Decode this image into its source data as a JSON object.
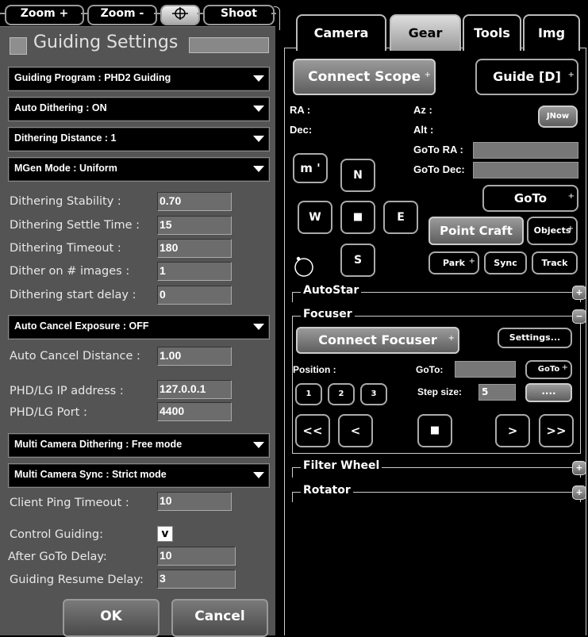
{
  "toolbar": {
    "zoom_in": "Zoom +",
    "zoom_out": "Zoom -",
    "shoot": "Shoot"
  },
  "settings": {
    "title": "Guiding Settings",
    "combos": {
      "program": "Guiding Program : PHD2 Guiding",
      "auto_dither": "Auto Dithering : ON",
      "dither_distance": "Dithering Distance : 1",
      "mgen_mode": "MGen Mode : Uniform",
      "auto_cancel": "Auto Cancel Exposure : OFF",
      "multi_dither": "Multi Camera Dithering : Free mode",
      "multi_sync": "Multi Camera Sync : Strict mode"
    },
    "fields": {
      "stability_label": "Dithering Stability :",
      "stability_value": "0.70",
      "settle_label": "Dithering Settle Time :",
      "settle_value": "15",
      "timeout_label": "Dithering Timeout :",
      "timeout_value": "180",
      "dither_images_label": "Dither on # images :",
      "dither_images_value": "1",
      "start_delay_label": "Dithering start delay :",
      "start_delay_value": "0",
      "cancel_distance_label": "Auto Cancel Distance :",
      "cancel_distance_value": "1.00",
      "ip_label": "PHD/LG IP address :",
      "ip_value": "127.0.0.1",
      "port_label": "PHD/LG Port :",
      "port_value": "4400",
      "ping_label": "Client Ping Timeout :",
      "ping_value": "10",
      "control_label": "Control Guiding:",
      "control_check": "v",
      "after_goto_label": "After GoTo Delay:",
      "after_goto_value": "10",
      "resume_label": "Guiding Resume Delay:",
      "resume_value": "3"
    },
    "ok": "OK",
    "cancel": "Cancel"
  },
  "tabs": [
    "Camera",
    "Gear",
    "Tools",
    "Img"
  ],
  "mount": {
    "connect": "Connect Scope",
    "guide": "Guide [D]",
    "ra": "RA :",
    "dec": "Dec:",
    "az": "Az :",
    "alt": "Alt :",
    "jnow": "JNow",
    "goto_ra": "GoTo RA :",
    "goto_dec": "GoTo Dec:",
    "m_btn": "m '",
    "n": "N",
    "w": "W",
    "stop": "■",
    "e": "E",
    "s": "S",
    "goto": "GoTo",
    "point_craft": "Point Craft",
    "objects": "Objects",
    "park": "Park",
    "sync": "Sync",
    "track": "Track"
  },
  "sections": {
    "autostar": "AutoStar",
    "focuser": "Focuser",
    "filter": "Filter Wheel",
    "rotator": "Rotator"
  },
  "focuser": {
    "connect": "Connect Focuser",
    "settings": "Settings...",
    "position": "Position :",
    "goto_label": "GoTo:",
    "goto_btn": "GoTo",
    "step_label": "Step size:",
    "step_value": "5",
    "dots": "....",
    "p1": "1",
    "p2": "2",
    "p3": "3",
    "far_left": "<<",
    "left": "<",
    "stop": "■",
    "right": ">",
    "far_right": ">>"
  }
}
